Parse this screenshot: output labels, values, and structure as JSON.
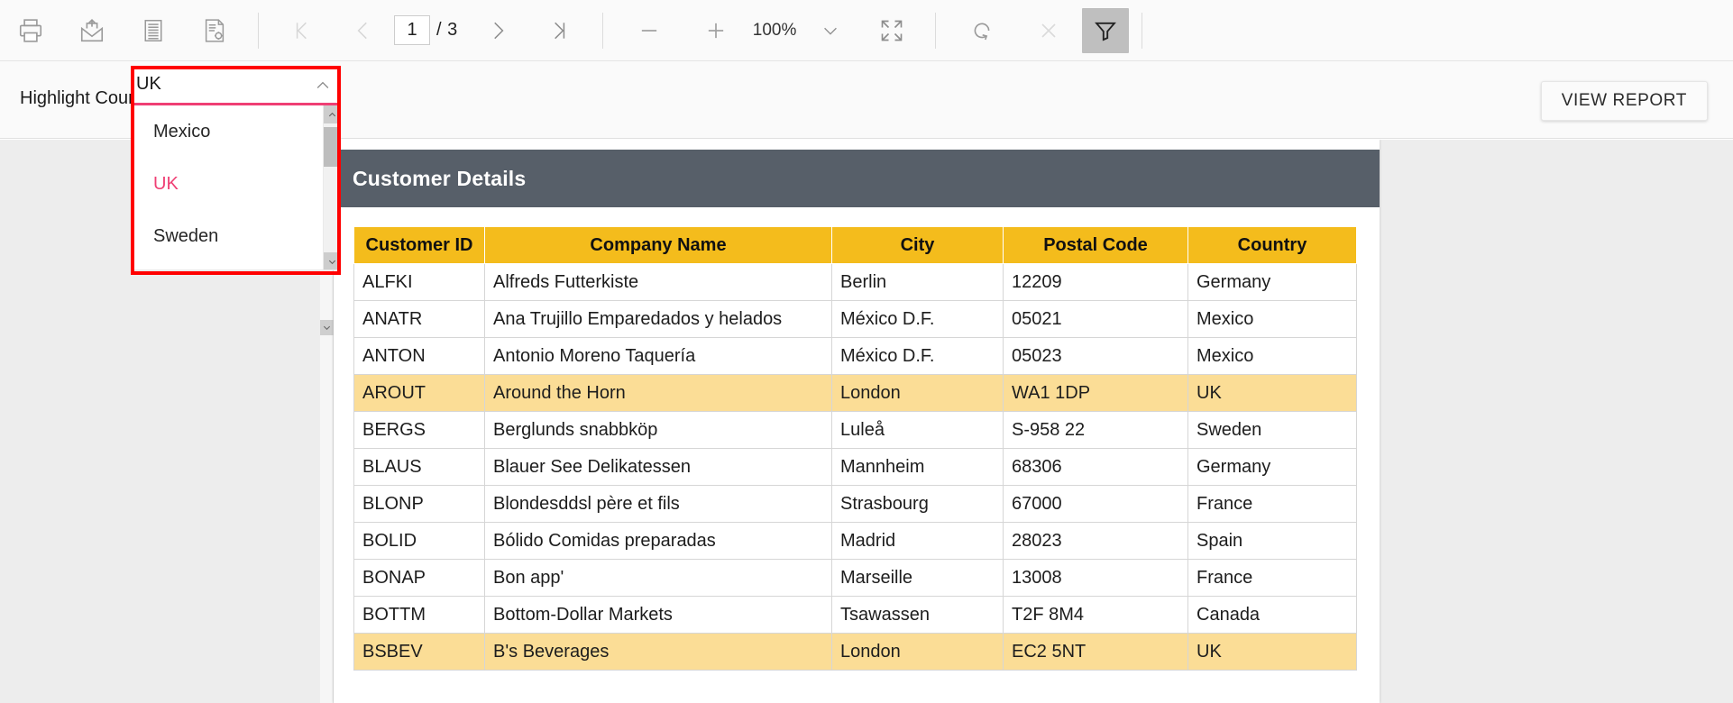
{
  "toolbar": {
    "buttons": [
      {
        "name": "print-icon",
        "label": "Print"
      },
      {
        "name": "export-icon",
        "label": "Export"
      },
      {
        "name": "document-map-icon",
        "label": "Document Map"
      },
      {
        "name": "page-setup-icon",
        "label": "Page Setup"
      }
    ],
    "pagination": {
      "first_label": "First page",
      "prev_label": "Previous page",
      "current_page": "1",
      "total_pages": "/ 3",
      "next_label": "Next page",
      "last_label": "Last page"
    },
    "zoom": {
      "minus_label": "Zoom out",
      "plus_label": "Zoom in",
      "value": "100%",
      "chevron": "chevron-down-icon",
      "fit_label": "Fit to page"
    },
    "actions": {
      "refresh_label": "Refresh",
      "stop_label": "Stop",
      "filter_label": "Parameters"
    }
  },
  "parameters": {
    "label": "Highlight Country",
    "view_report_label": "VIEW REPORT",
    "combo": {
      "value": "UK",
      "expanded": true,
      "options": [
        "Mexico",
        "UK",
        "Sweden"
      ],
      "selected": "UK",
      "accent_color": "#ef3f74",
      "annotation_color": "#ff0000"
    }
  },
  "report": {
    "title": "Customer Details",
    "banner_color": "#575f69",
    "header_color": "#f4bc1c",
    "highlight_color": "#fbdd96",
    "columns": [
      "Customer ID",
      "Company Name",
      "City",
      "Postal Code",
      "Country"
    ],
    "rows": [
      {
        "id": "ALFKI",
        "company": "Alfreds Futterkiste",
        "city": "Berlin",
        "postal": "12209",
        "country": "Germany",
        "highlight": false
      },
      {
        "id": "ANATR",
        "company": "Ana Trujillo Emparedados y helados",
        "city": "México D.F.",
        "postal": "05021",
        "country": "Mexico",
        "highlight": false
      },
      {
        "id": "ANTON",
        "company": "Antonio Moreno Taquería",
        "city": "México D.F.",
        "postal": "05023",
        "country": "Mexico",
        "highlight": false
      },
      {
        "id": "AROUT",
        "company": "Around the Horn",
        "city": "London",
        "postal": "WA1 1DP",
        "country": "UK",
        "highlight": true
      },
      {
        "id": "BERGS",
        "company": "Berglunds snabbköp",
        "city": "Luleå",
        "postal": "S-958 22",
        "country": "Sweden",
        "highlight": false
      },
      {
        "id": "BLAUS",
        "company": "Blauer See Delikatessen",
        "city": "Mannheim",
        "postal": "68306",
        "country": "Germany",
        "highlight": false
      },
      {
        "id": "BLONP",
        "company": "Blondesddsl père et fils",
        "city": "Strasbourg",
        "postal": "67000",
        "country": "France",
        "highlight": false
      },
      {
        "id": "BOLID",
        "company": "Bólido Comidas preparadas",
        "city": "Madrid",
        "postal": "28023",
        "country": "Spain",
        "highlight": false
      },
      {
        "id": "BONAP",
        "company": "Bon app'",
        "city": "Marseille",
        "postal": "13008",
        "country": "France",
        "highlight": false
      },
      {
        "id": "BOTTM",
        "company": "Bottom-Dollar Markets",
        "city": "Tsawassen",
        "postal": "T2F 8M4",
        "country": "Canada",
        "highlight": false
      },
      {
        "id": "BSBEV",
        "company": "B's Beverages",
        "city": "London",
        "postal": "EC2 5NT",
        "country": "UK",
        "highlight": true
      }
    ]
  }
}
